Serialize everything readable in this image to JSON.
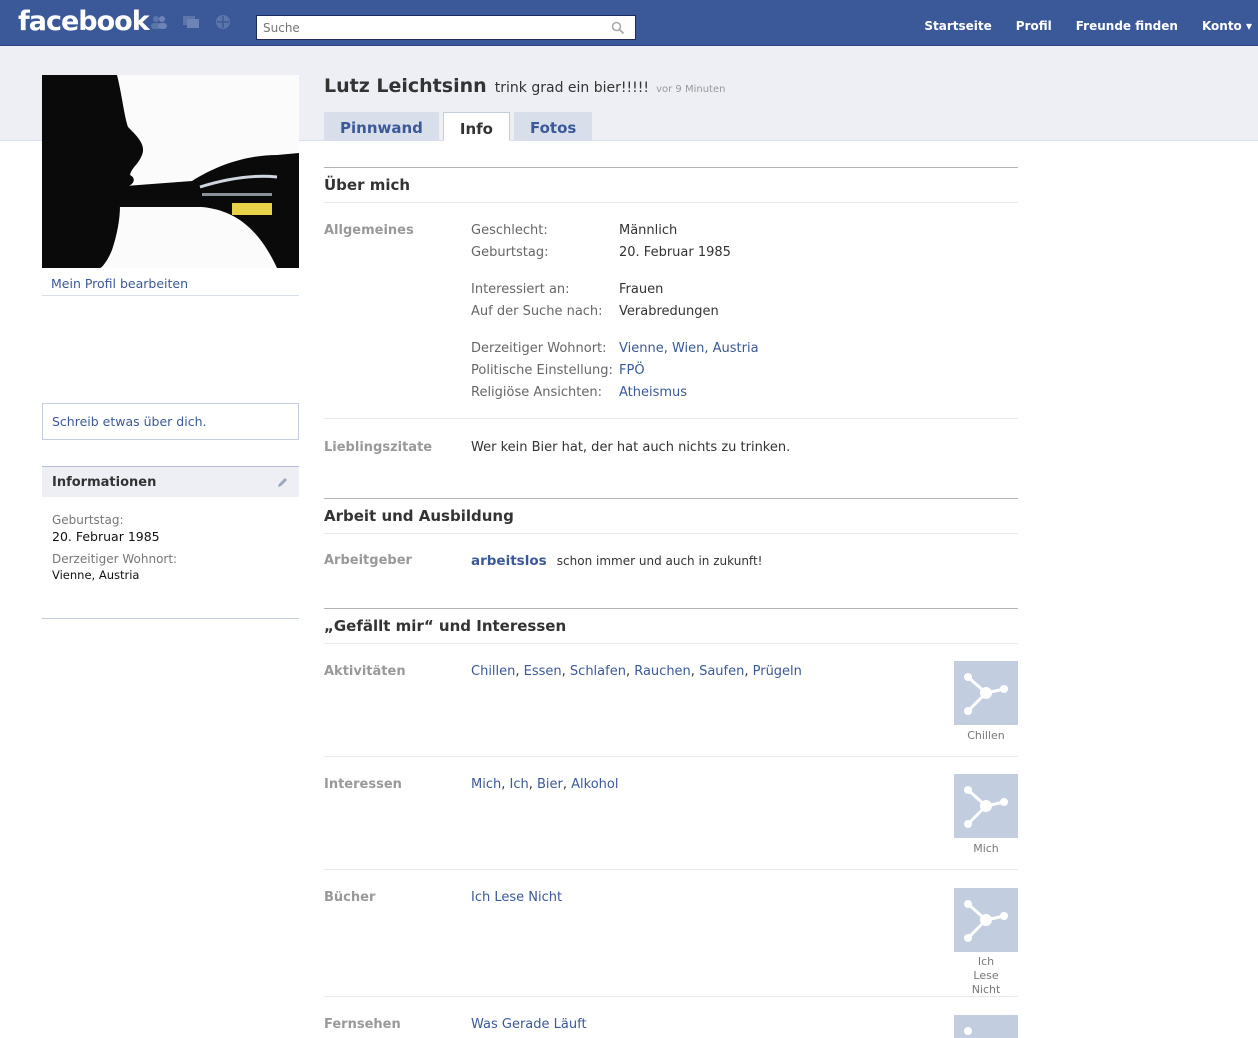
{
  "topbar": {
    "logo": "facebook",
    "search_placeholder": "Suche",
    "nav": [
      "Startseite",
      "Profil",
      "Freunde finden",
      "Konto ▾"
    ],
    "icons": [
      "friend-requests-icon",
      "messages-icon",
      "notifications-icon",
      "search-icon"
    ]
  },
  "left": {
    "edit_profile": "Mein Profil bearbeiten",
    "about_prompt": "Schreib etwas über dich.",
    "info_title": "Informationen",
    "birthday_label": "Geburtstag:",
    "birthday_value": "20. Februar 1985",
    "residence_label": "Derzeitiger Wohnort:",
    "residence_value": "Vienne, Austria"
  },
  "profile": {
    "name": "Lutz Leichtsinn",
    "status": "trink grad ein bier!!!!!",
    "status_time": "vor 9 Minuten",
    "tabs": [
      "Pinnwand",
      "Info",
      "Fotos"
    ],
    "active_tab": "Info"
  },
  "about": {
    "title": "Über mich",
    "general_label": "Allgemeines",
    "gender_k": "Geschlecht:",
    "gender_v": "Männlich",
    "birthday_k": "Geburtstag:",
    "birthday_v": "20. Februar 1985",
    "interested_k": "Interessiert an:",
    "interested_v": "Frauen",
    "looking_k": "Auf der Suche nach:",
    "looking_v": "Verabredungen",
    "residence_k": "Derzeitiger Wohnort:",
    "residence_v": "Vienne, Wien, Austria",
    "politics_k": "Politische Einstellung:",
    "politics_v": "FPÖ",
    "religion_k": "Religiöse Ansichten:",
    "religion_v": "Atheismus",
    "quotes_label": "Lieblingszitate",
    "quotes_v": "Wer kein Bier hat, der hat auch nichts zu trinken."
  },
  "work": {
    "title": "Arbeit und Ausbildung",
    "employer_label": "Arbeitgeber",
    "employer": "arbeitslos",
    "employer_note": "schon immer und auch in zukunft!"
  },
  "likes": {
    "title": "„Gefällt mir“ und Interessen",
    "rows": [
      {
        "label": "Aktivitäten",
        "items": [
          "Chillen",
          "Essen",
          "Schlafen",
          "Rauchen",
          "Saufen",
          "Prügeln"
        ],
        "caption": "Chillen"
      },
      {
        "label": "Interessen",
        "items": [
          "Mich",
          "Ich",
          "Bier",
          "Alkohol"
        ],
        "caption": "Mich"
      },
      {
        "label": "Bücher",
        "items": [
          "Ich Lese Nicht"
        ],
        "caption": "Ich Lese Nicht"
      },
      {
        "label": "Fernsehen",
        "items": [
          "Was Gerade Läuft"
        ],
        "caption": ""
      }
    ]
  },
  "colors": {
    "brand": "#3b5998",
    "band": "#edeff4"
  }
}
